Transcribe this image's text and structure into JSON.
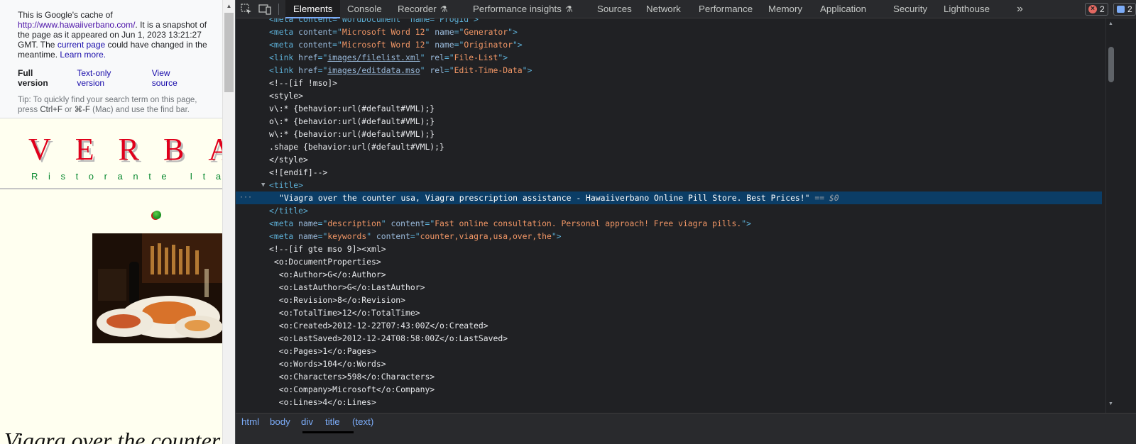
{
  "cache_banner": {
    "line1_prefix": "This is Google's cache of",
    "url": "http://www.hawaiiverbano.com/",
    "line2": ". It is a snapshot of the page as it appeared on Jun 1, 2023 13:21:27 GMT. The",
    "current_page": "current page",
    "line3": "could have changed in the meantime.",
    "learn_more": "Learn more.",
    "full_version": "Full version",
    "text_only": "Text-only version",
    "view_source": "View source",
    "tip_prefix": "Tip: To quickly find your search term on this page, press",
    "key1": "Ctrl+F",
    "or": "or",
    "key2": "⌘-F",
    "tip_suffix": "(Mac) and use the find bar."
  },
  "site": {
    "logo": "VERBANO",
    "tagline": "Ristorante Italiano",
    "heading": "Viagra over the counter"
  },
  "devtools": {
    "tabs": [
      "Elements",
      "Console",
      "Recorder",
      "Performance insights",
      "Sources",
      "Network",
      "Performance",
      "Memory",
      "Application",
      "Security",
      "Lighthouse"
    ],
    "active_tab": "Elements",
    "error_count": "2",
    "message_count": "2",
    "breadcrumbs": [
      "html",
      "body",
      "div",
      "title",
      "(text)"
    ],
    "dom_lines": {
      "l0": "<meta content=\"WordDocument\" name=\"ProgId\">",
      "l1_an": "content",
      "l1_av": "Microsoft Word 12",
      "l1_an2": "name",
      "l1_av2": "Generator",
      "l2_an": "content",
      "l2_av": "Microsoft Word 12",
      "l2_an2": "name",
      "l2_av2": "Originator",
      "l3_av": "images/filelist.xml",
      "l3_av2": "File-List",
      "l4_av": "images/editdata.mso",
      "l4_av2": "Edit-Time-Data",
      "l5": "<!--[if !mso]>",
      "l6": "<style>",
      "l7": "v\\:* {behavior:url(#default#VML);}",
      "l8": "o\\:* {behavior:url(#default#VML);}",
      "l9": "w\\:* {behavior:url(#default#VML);}",
      "l10": ".shape {behavior:url(#default#VML);}",
      "l11": "</style>",
      "l12": "<![endif]-->",
      "l13": "<title>",
      "l14": "\"Viagra over the counter usa, Viagra prescription assistance - Hawaiiverbano Online Pill Store. Best Prices!\"",
      "l14_eq": "== $0",
      "l15": "</title>",
      "l16_av": "description",
      "l16_av2": "Fast online consultation. Personal approach! Free viagra pills.",
      "l17_av": "keywords",
      "l17_av2": "counter,viagra,usa,over,the",
      "l18": "<!--[if gte mso 9]><xml>",
      "l19": " <o:DocumentProperties>",
      "l20": "  <o:Author>G</o:Author>",
      "l21": "  <o:LastAuthor>G</o:LastAuthor>",
      "l22": "  <o:Revision>8</o:Revision>",
      "l23": "  <o:TotalTime>12</o:TotalTime>",
      "l24": "  <o:Created>2012-12-22T07:43:00Z</o:Created>",
      "l25": "  <o:LastSaved>2012-12-24T08:58:00Z</o:LastSaved>",
      "l26": "  <o:Pages>1</o:Pages>",
      "l27": "  <o:Words>104</o:Words>",
      "l28": "  <o:Characters>598</o:Characters>",
      "l29": "  <o:Company>Microsoft</o:Company>",
      "l30": "  <o:Lines>4</o:Lines>"
    }
  },
  "colors": {
    "selection": "#0b3d66",
    "tag": "#5db0d7",
    "attr_value": "#f29766",
    "accent": "#7cacf8"
  }
}
